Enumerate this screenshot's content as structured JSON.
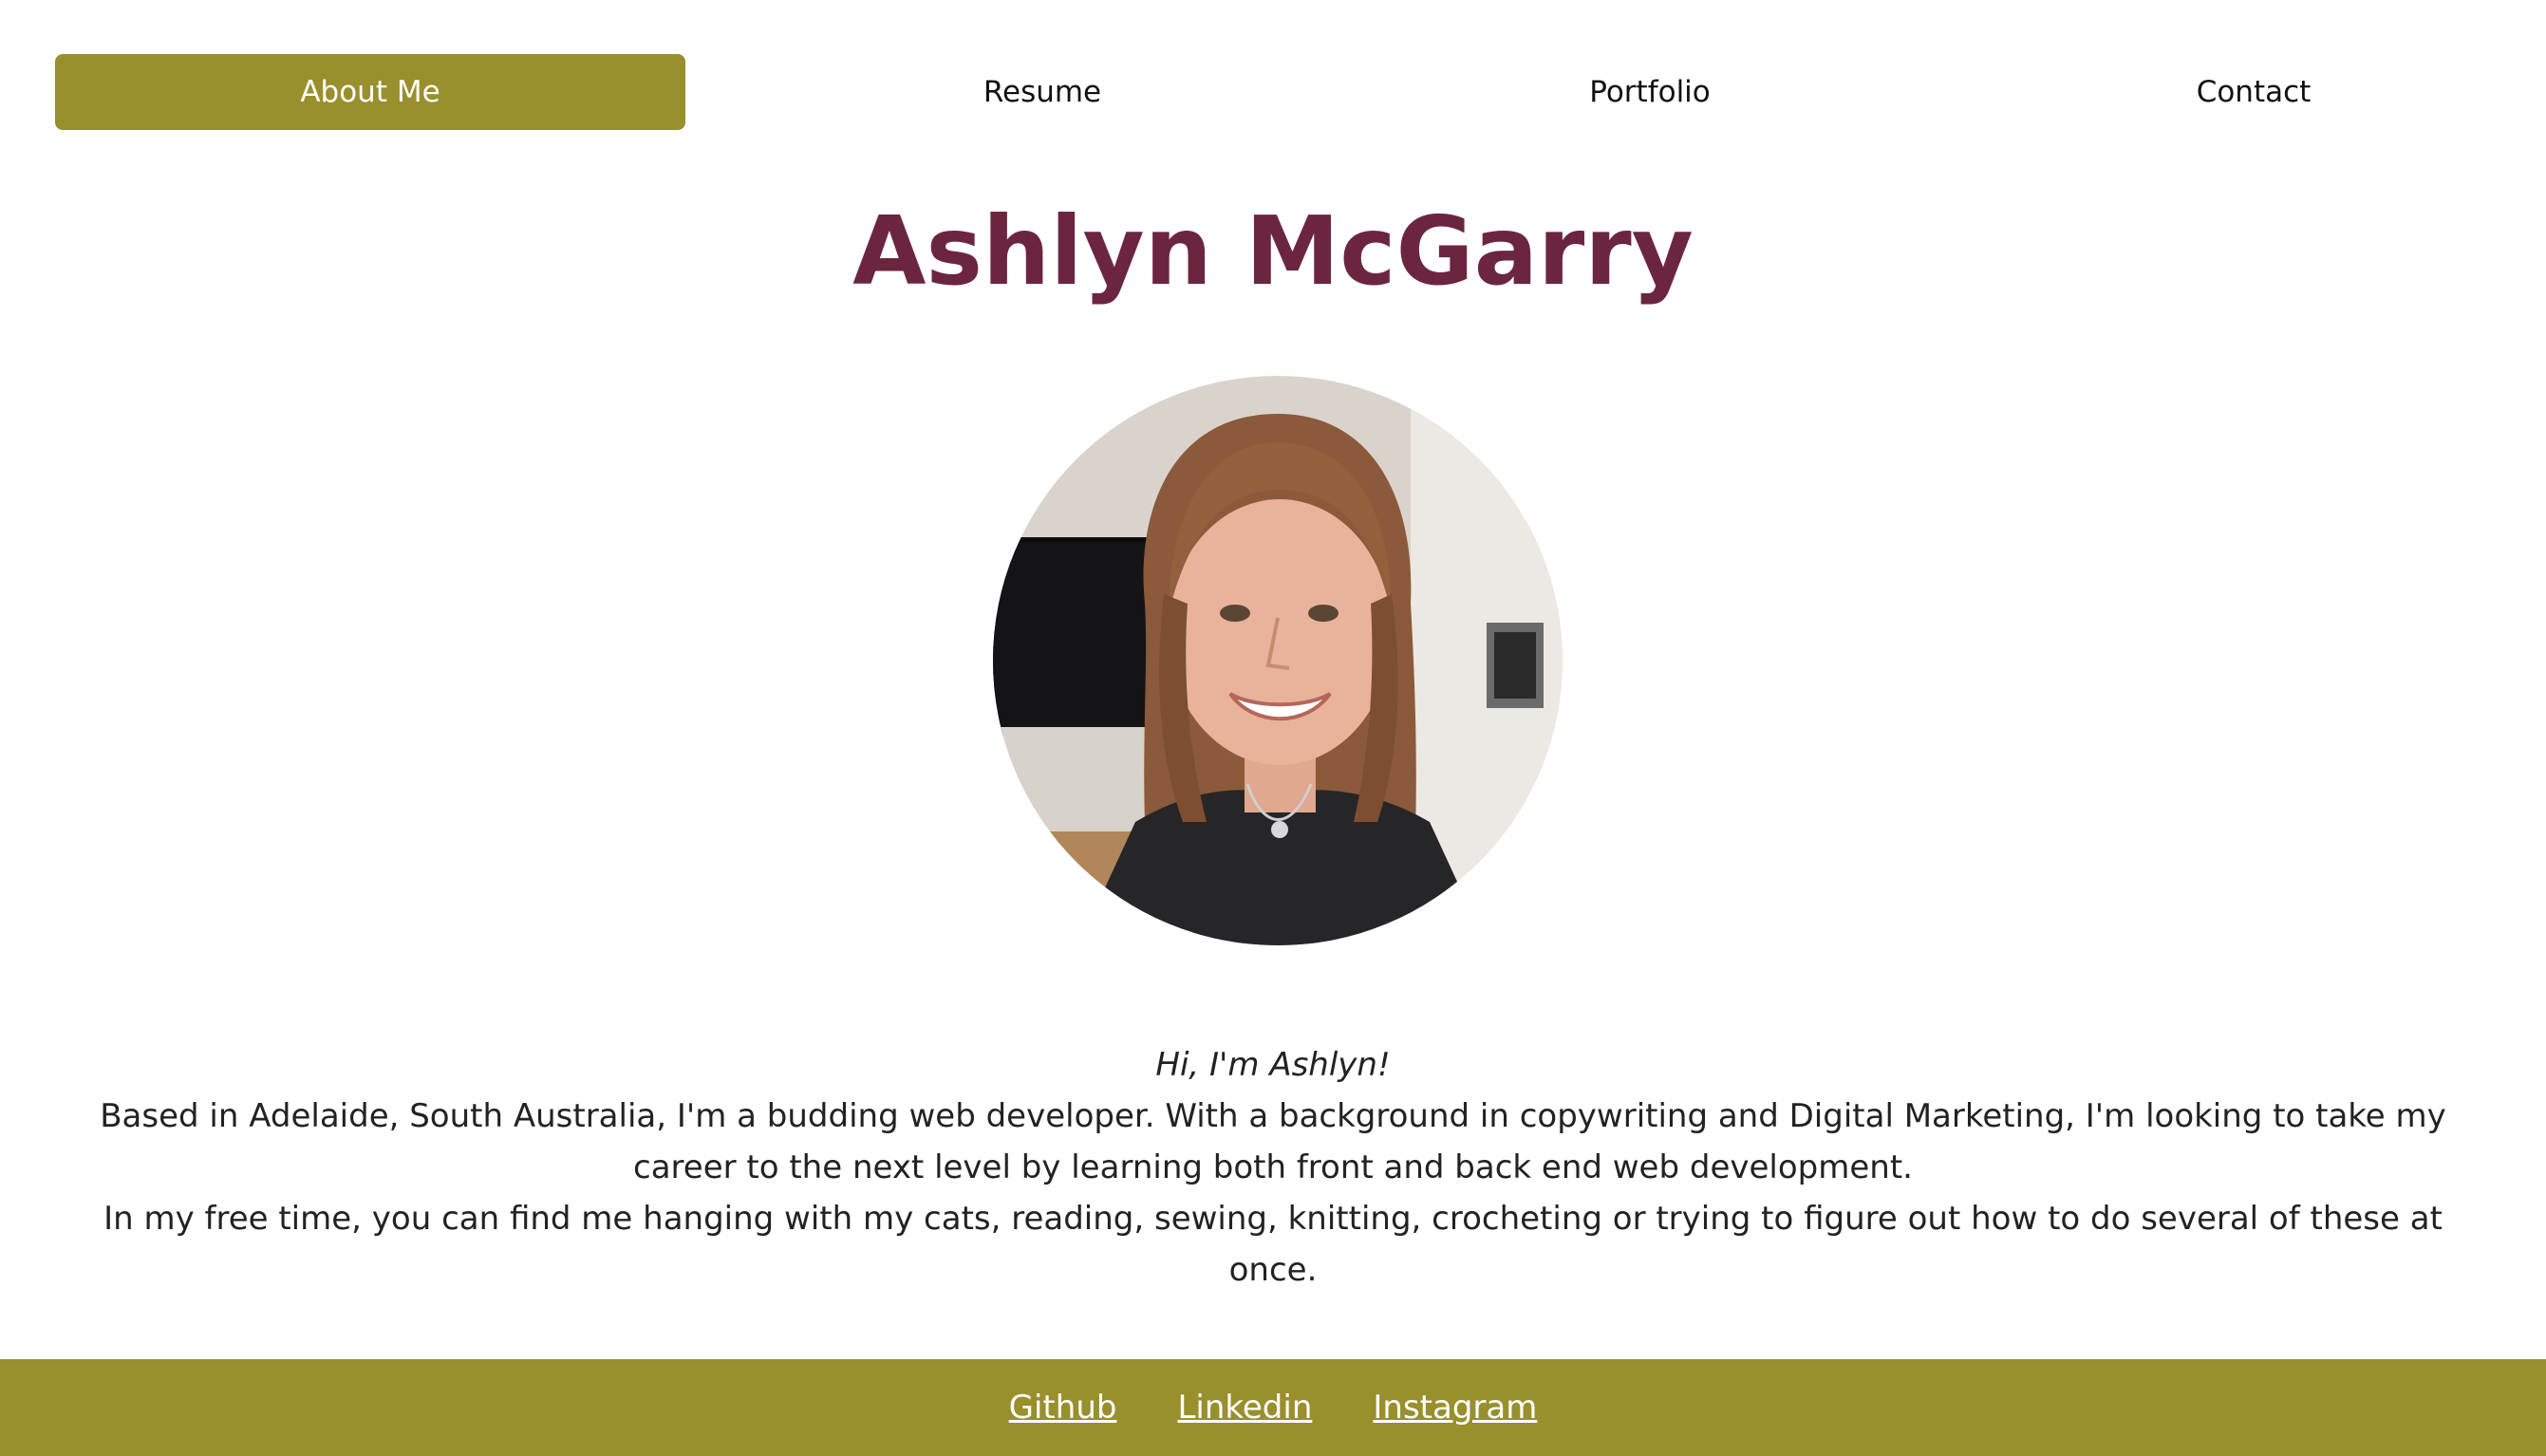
{
  "nav": {
    "items": [
      {
        "label": "About Me",
        "active": true
      },
      {
        "label": "Resume",
        "active": false
      },
      {
        "label": "Portfolio",
        "active": false
      },
      {
        "label": "Contact",
        "active": false
      }
    ]
  },
  "header": {
    "name": "Ashlyn McGarry"
  },
  "profile_photo": {
    "icon": "profile-photo"
  },
  "intro": {
    "greeting": "Hi, I'm Ashlyn!",
    "paragraph_1": "Based in Adelaide, South Australia, I'm a budding web developer. With a background in copywriting and Digital Marketing, I'm looking to take my career to the next level by learning both front and back end web development.",
    "paragraph_2": "In my free time, you can find me hanging with my cats, reading, sewing, knitting, crocheting or trying to figure out how to do several of these at once."
  },
  "footer": {
    "links": [
      {
        "label": "Github"
      },
      {
        "label": "Linkedin"
      },
      {
        "label": "Instagram"
      }
    ]
  },
  "colors": {
    "accent": "#998f2c",
    "name": "#6c2540",
    "text": "#222222"
  }
}
